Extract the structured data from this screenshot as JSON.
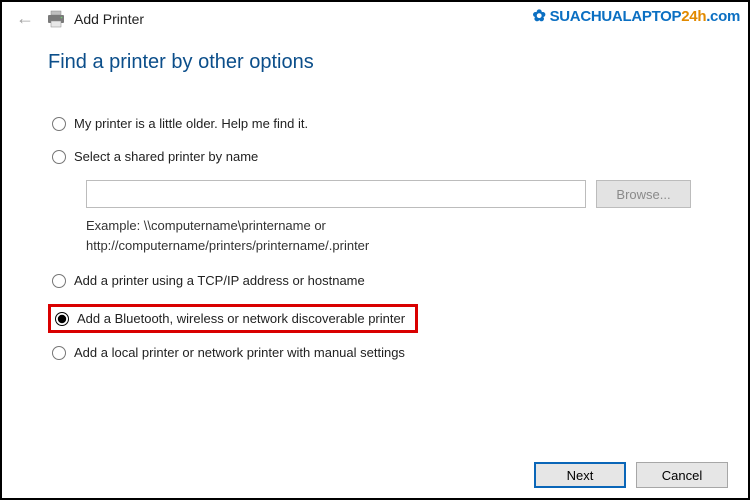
{
  "title": "Add Printer",
  "heading": "Find a printer by other options",
  "options": {
    "older": "My printer is a little older. Help me find it.",
    "shared": "Select a shared printer by name",
    "tcpip": "Add a printer using a TCP/IP address or hostname",
    "bluetooth": "Add a Bluetooth, wireless or network discoverable printer",
    "local": "Add a local printer or network printer with manual settings"
  },
  "shared": {
    "input_value": "",
    "placeholder": "",
    "browse_label": "Browse...",
    "example_line1": "Example: \\\\computername\\printername or",
    "example_line2": "http://computername/printers/printername/.printer"
  },
  "footer": {
    "next": "Next",
    "cancel": "Cancel"
  },
  "watermark": {
    "part1": "SUACHUALAPTOP",
    "part2": "24h",
    "part3": ".com"
  }
}
